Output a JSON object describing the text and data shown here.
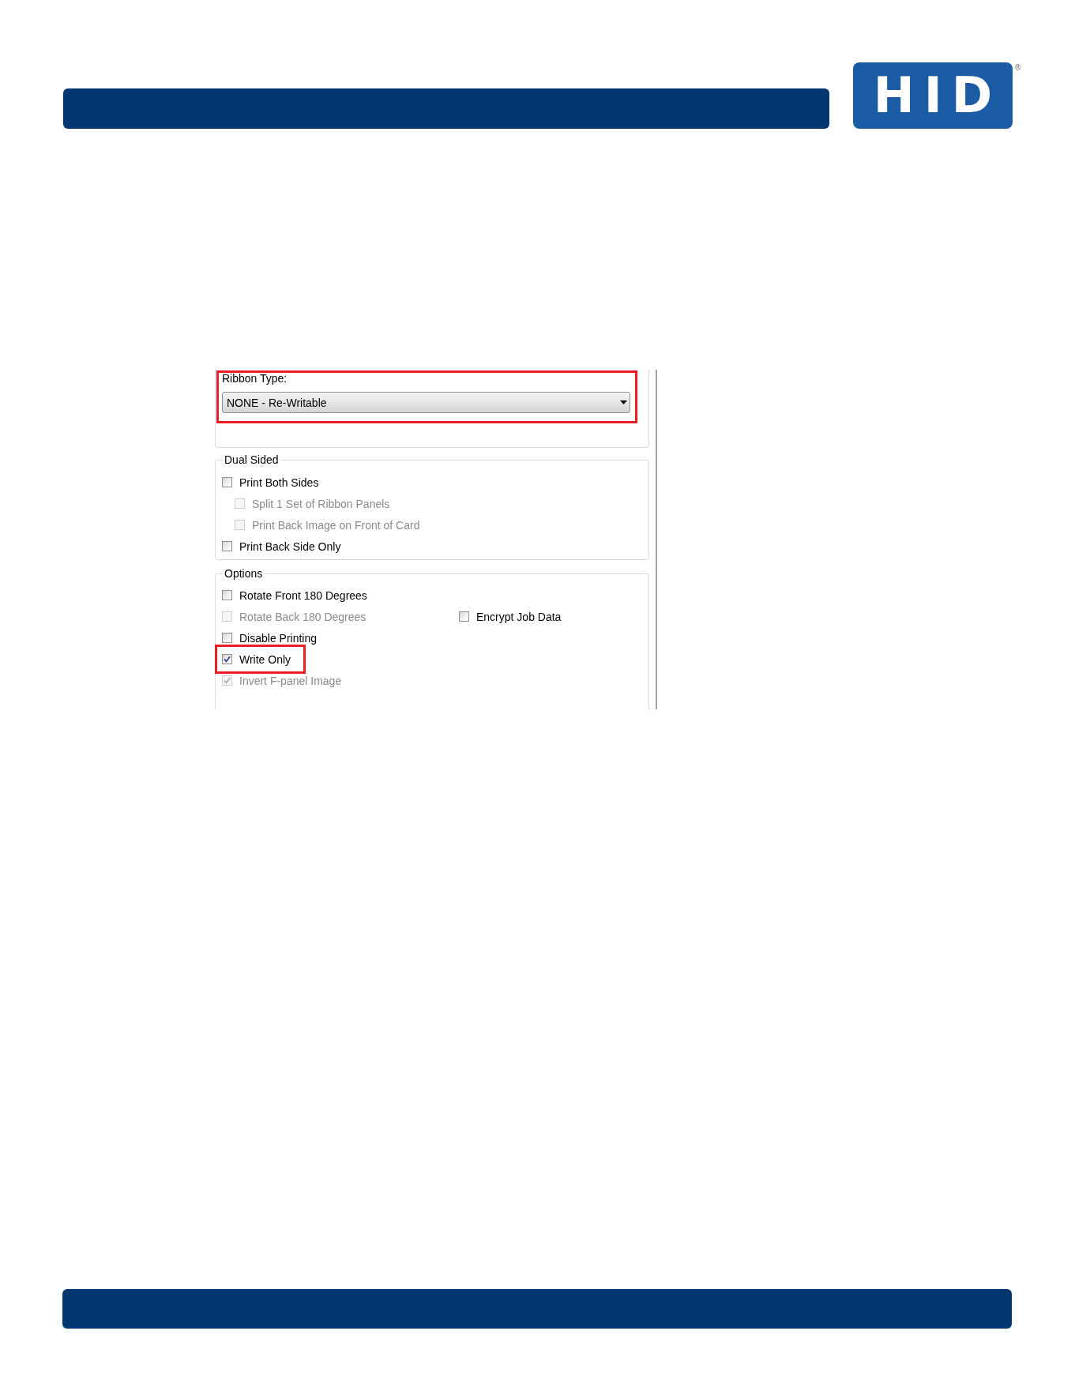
{
  "header": {
    "logo": {
      "text": "HID",
      "mark": "®"
    }
  },
  "settings": {
    "ribbon_type": {
      "label": "Ribbon Type:",
      "value": "NONE - Re-Writable",
      "highlighted": true
    },
    "dual_sided": {
      "title": "Dual Sided",
      "items": [
        {
          "label": "Print Both Sides",
          "checked": false,
          "disabled": false,
          "highlighted": false,
          "children": [
            {
              "label": "Split 1 Set of Ribbon Panels",
              "checked": false,
              "disabled": true,
              "highlighted": false
            },
            {
              "label": "Print Back Image on Front of Card",
              "checked": false,
              "disabled": true,
              "highlighted": false
            }
          ]
        },
        {
          "label": "Print Back Side Only",
          "checked": false,
          "disabled": false,
          "highlighted": false
        }
      ]
    },
    "options": {
      "title": "Options",
      "rows": [
        {
          "items": [
            {
              "label": "Rotate Front 180 Degrees",
              "checked": false,
              "disabled": false,
              "highlighted": false
            }
          ]
        },
        {
          "items": [
            {
              "label": "Rotate Back 180 Degrees",
              "checked": false,
              "disabled": true,
              "highlighted": false
            },
            {
              "label": "Encrypt Job Data",
              "checked": false,
              "disabled": false,
              "highlighted": false
            }
          ]
        },
        {
          "items": [
            {
              "label": "Disable Printing",
              "checked": false,
              "disabled": false,
              "highlighted": false
            }
          ]
        },
        {
          "items": [
            {
              "label": "Write Only",
              "checked": true,
              "disabled": false,
              "highlighted": true
            }
          ]
        },
        {
          "items": [
            {
              "label": "Invert F-panel Image",
              "checked": true,
              "disabled": true,
              "highlighted": false
            }
          ]
        }
      ]
    }
  }
}
